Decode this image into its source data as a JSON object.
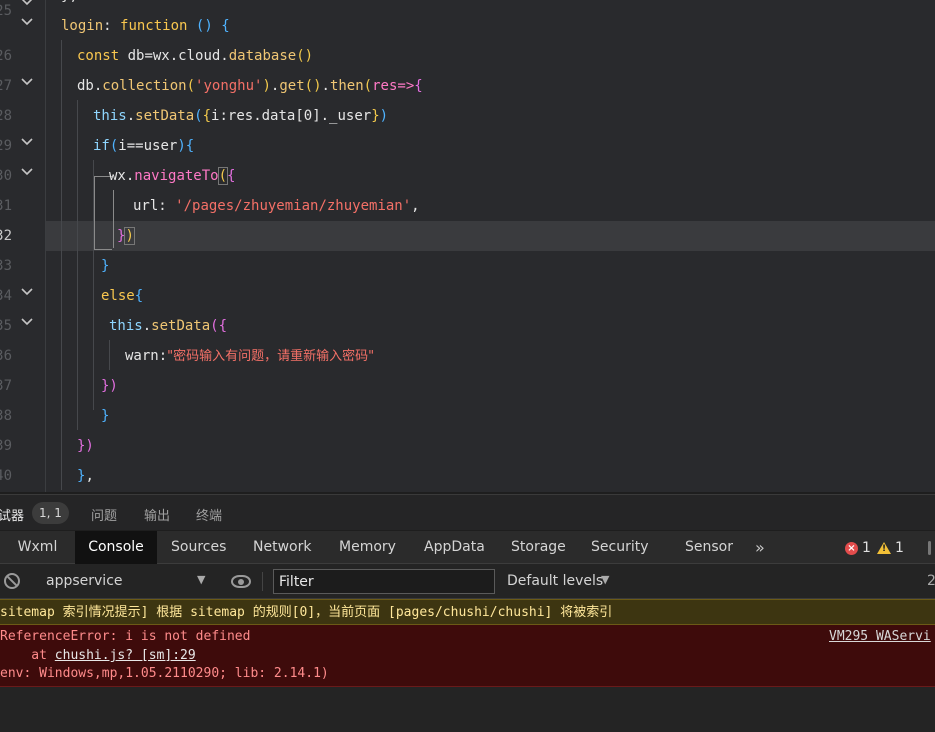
{
  "editor": {
    "line_numbers": [
      "25",
      "26",
      "27",
      "28",
      "29",
      "30",
      "31",
      "32",
      "33",
      "34",
      "35",
      "36",
      "37",
      "38",
      "39",
      "40"
    ],
    "active_line": "32",
    "tokens": {
      "login": "login",
      "function_kw": "function",
      "const_kw": "const",
      "db_assign": "db=wx.cloud.",
      "database_fn": "database",
      "db_prefix": "db.",
      "collection_fn": "collection",
      "yonghu_str": "'yonghu'",
      "get_fn": "get",
      "then_fn": "then",
      "res_param": "res",
      "this_kw": "this",
      "setData_fn": "setData",
      "setdata_args": "i:res.data[0]._user",
      "if_kw": "if",
      "if_cond": "i==user",
      "wx_prefix": "wx.",
      "navigateTo_fn": "navigateTo",
      "url_key": "url",
      "url_str": "'/pages/zhuyemian/zhuyemian'",
      "else_kw": "else",
      "warn_key": "warn",
      "warn_str": "\"密码输入有问题，请重新输入密码\""
    }
  },
  "panel_tabs": {
    "debugger": "试器",
    "cursor_pos": "1, 1",
    "problems": "问题",
    "output": "输出",
    "terminal": "终端"
  },
  "devtools": {
    "tabs": [
      "Wxml",
      "Console",
      "Sources",
      "Network",
      "Memory",
      "AppData",
      "Storage",
      "Security",
      "Sensor"
    ],
    "active_tab": "Console",
    "more": "»",
    "error_count": "1",
    "warning_count": "1"
  },
  "toolbar": {
    "context": "appservice",
    "filter_placeholder": "Filter",
    "levels": "Default levels",
    "count": "2"
  },
  "console": {
    "warning": "sitemap 索引情况提示] 根据 sitemap 的规则[0]，当前页面 [pages/chushi/chushi] 将被索引",
    "error_line1": "ReferenceError: i is not defined",
    "error_at": "    at ",
    "error_link": "chushi.js? [sm]:29",
    "error_env": "env: Windows,mp,1.05.2110290; lib: 2.14.1)",
    "error_source": "VM295 WAServi"
  },
  "colors": {
    "editor_bg": "#292a2d",
    "active_tab_bg": "#111111",
    "warning_bg": "#3d3511",
    "error_bg": "#3e0b0b"
  }
}
